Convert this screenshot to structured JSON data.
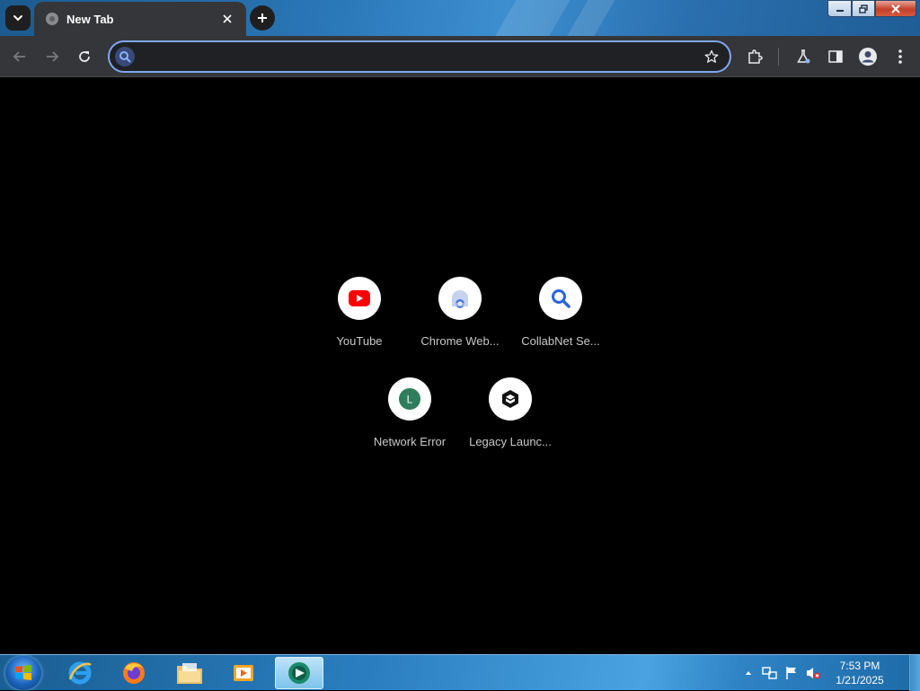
{
  "browser": {
    "tab": {
      "title": "New Tab"
    },
    "omnibox": {
      "value": "",
      "placeholder": ""
    }
  },
  "shortcuts": [
    {
      "label": "YouTube",
      "icon": "youtube-icon"
    },
    {
      "label": "Chrome Web...",
      "icon": "chrome-web-store-icon"
    },
    {
      "label": "CollabNet Se...",
      "icon": "collabnet-search-icon"
    },
    {
      "label": "Network Error",
      "icon": "letter-l-icon",
      "letter": "L"
    },
    {
      "label": "Legacy Launc...",
      "icon": "legacy-launcher-icon"
    }
  ],
  "taskbar": {
    "clock": {
      "time": "7:53 PM",
      "date": "1/21/2025"
    },
    "pinned": [
      "internet-explorer-icon",
      "firefox-icon",
      "file-explorer-icon",
      "media-player-icon",
      "chrome-icon"
    ]
  },
  "colors": {
    "omnibox_border": "#7ea7f0",
    "youtube_red": "#ff0000",
    "collabnet_blue": "#2b63d9",
    "network_error_green": "#2e7d5b"
  }
}
